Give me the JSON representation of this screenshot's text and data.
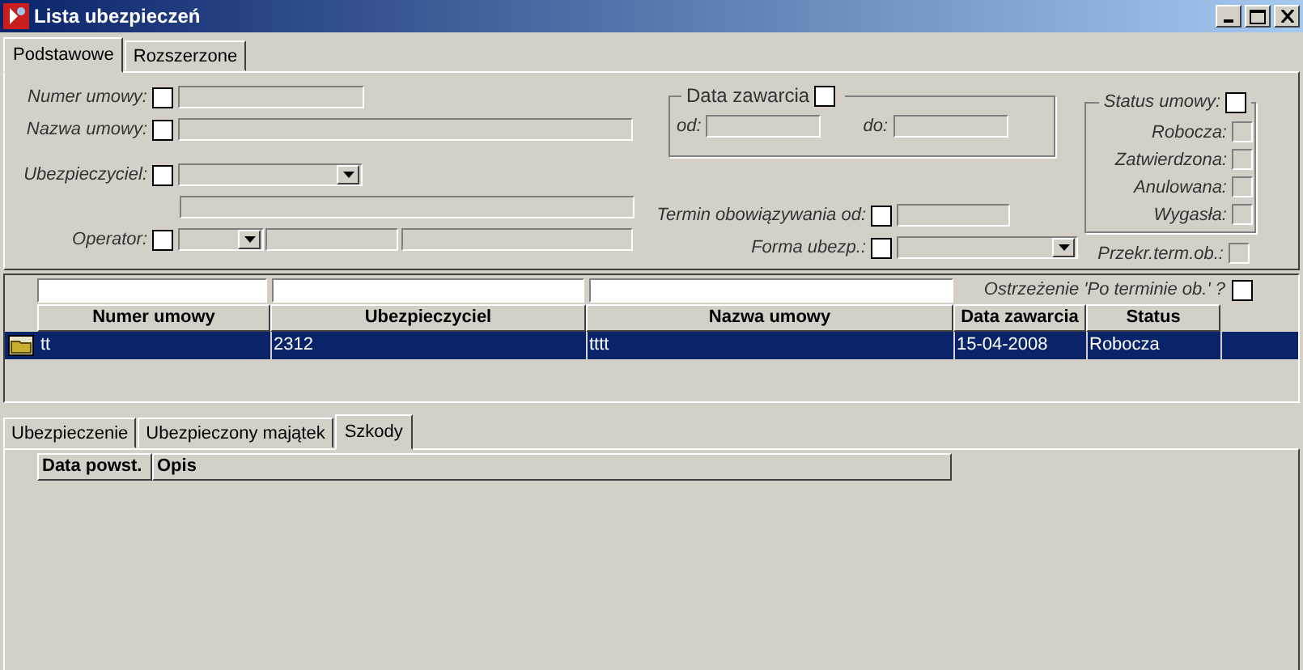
{
  "window": {
    "title": "Lista ubezpieczeń"
  },
  "filter_tabs": [
    {
      "label": "Podstawowe",
      "selected": true
    },
    {
      "label": "Rozszerzone",
      "selected": false
    }
  ],
  "filter": {
    "numer_umowy": {
      "label": "Numer umowy:",
      "checked": false
    },
    "nazwa_umowy": {
      "label": "Nazwa umowy:",
      "checked": false
    },
    "ubezpieczyciel": {
      "label": "Ubezpieczyciel:",
      "checked": false
    },
    "operator": {
      "label": "Operator:",
      "checked": false
    },
    "data_zawarcia": {
      "label": "Data zawarcia",
      "checked": false,
      "from_label": "od:",
      "to_label": "do:"
    },
    "termin": {
      "label": "Termin obowiązywania od:",
      "checked": false
    },
    "forma": {
      "label": "Forma ubezp.:",
      "checked": false
    },
    "status": {
      "label": "Status umowy:",
      "checked": false,
      "options": [
        {
          "label": "Robocza:",
          "checked": false,
          "disabled": true
        },
        {
          "label": "Zatwierdzona:",
          "checked": false,
          "disabled": true
        },
        {
          "label": "Anulowana:",
          "checked": false,
          "disabled": true
        },
        {
          "label": "Wygasła:",
          "checked": false,
          "disabled": true
        }
      ]
    },
    "przekr": {
      "label": "Przekr.term.ob.:",
      "checked": false,
      "disabled": true
    }
  },
  "grid": {
    "warning": {
      "label": "Ostrzeżenie 'Po terminie ob.' ?",
      "checked": false
    },
    "columns": [
      "Numer umowy",
      "Ubezpieczyciel",
      "Nazwa umowy",
      "Data zawarcia",
      "Status"
    ],
    "rows": [
      {
        "selected": true,
        "cells": [
          "tt",
          "2312",
          "tttt",
          "15-04-2008",
          "Robocza"
        ]
      }
    ]
  },
  "detail_tabs": [
    {
      "label": "Ubezpieczenie",
      "selected": false
    },
    {
      "label": "Ubezpieczony majątek",
      "selected": false
    },
    {
      "label": "Szkody",
      "selected": true
    }
  ],
  "detail_grid": {
    "columns": [
      "Data powst.",
      "Opis"
    ]
  }
}
